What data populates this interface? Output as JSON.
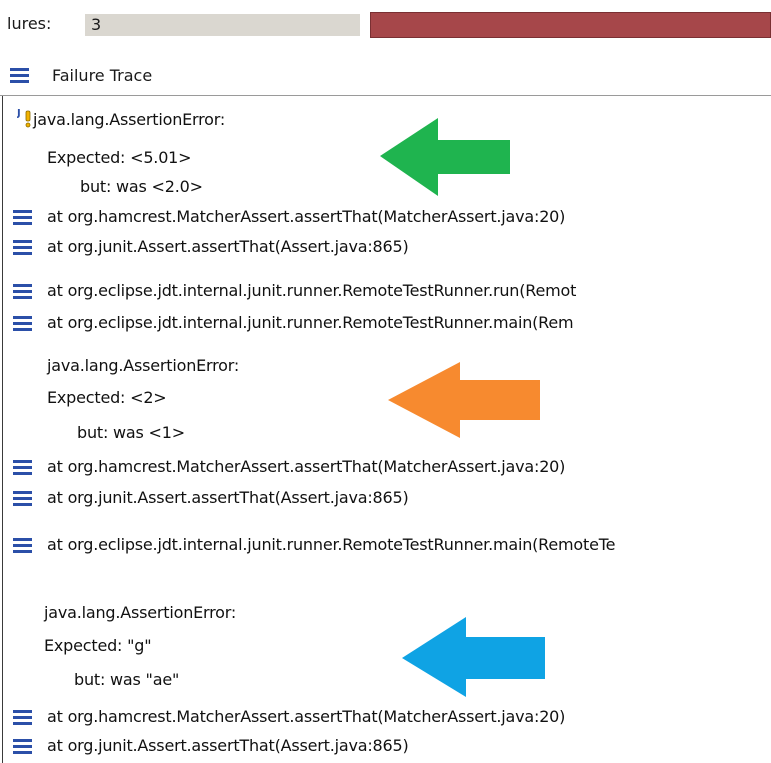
{
  "header": {
    "failures_label": "lures:",
    "failures_count": "3",
    "progress_color": "#a6474a"
  },
  "trace_header": {
    "label": "Failure Trace"
  },
  "trace": [
    {
      "text": "java.lang.AssertionError:",
      "icon": "junit-warning-icon"
    },
    {
      "text": "Expected: <5.01>",
      "icon": null
    },
    {
      "text": "but: was <2.0>",
      "icon": null
    },
    {
      "text": "at org.hamcrest.MatcherAssert.assertThat(MatcherAssert.java:20)",
      "icon": "stack-frame-icon"
    },
    {
      "text": "at org.junit.Assert.assertThat(Assert.java:865)",
      "icon": "stack-frame-icon"
    },
    {
      "text": "at org.eclipse.jdt.internal.junit.runner.RemoteTestRunner.run(Remot",
      "icon": "stack-frame-icon"
    },
    {
      "text": "at org.eclipse.jdt.internal.junit.runner.RemoteTestRunner.main(Rem",
      "icon": "stack-frame-icon"
    },
    {
      "text": "java.lang.AssertionError:",
      "icon": null
    },
    {
      "text": "Expected: <2>",
      "icon": null
    },
    {
      "text": "but: was <1>",
      "icon": null
    },
    {
      "text": "at org.hamcrest.MatcherAssert.assertThat(MatcherAssert.java:20)",
      "icon": "stack-frame-icon"
    },
    {
      "text": "at org.junit.Assert.assertThat(Assert.java:865)",
      "icon": "stack-frame-icon"
    },
    {
      "text": "at org.eclipse.jdt.internal.junit.runner.RemoteTestRunner.main(RemoteTe",
      "icon": "stack-frame-icon"
    },
    {
      "text": "java.lang.AssertionError:",
      "icon": null
    },
    {
      "text": "Expected: \"g\"",
      "icon": null
    },
    {
      "text": "but: was \"ae\"",
      "icon": null
    },
    {
      "text": "at org.hamcrest.MatcherAssert.assertThat(MatcherAssert.java:20)",
      "icon": "stack-frame-icon"
    },
    {
      "text": "at org.junit.Assert.assertThat(Assert.java:865)",
      "icon": "stack-frame-icon"
    }
  ],
  "arrows": [
    {
      "name": "green-arrow",
      "color": "#1fb44f"
    },
    {
      "name": "orange-arrow",
      "color": "#f78a2f"
    },
    {
      "name": "blue-arrow",
      "color": "#0fa3e4"
    }
  ]
}
